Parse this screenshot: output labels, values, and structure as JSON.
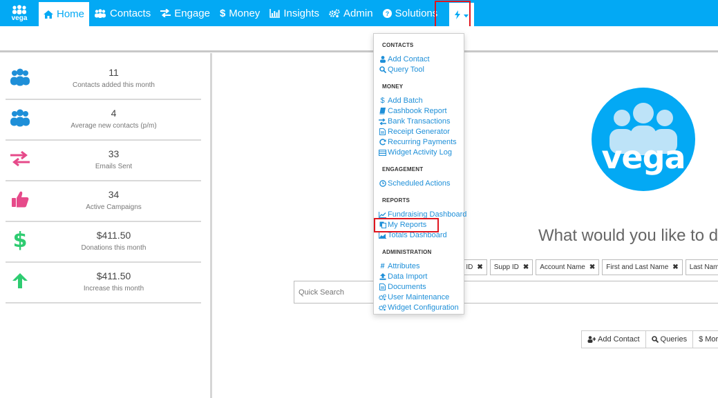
{
  "brand": {
    "logo_text": "vega",
    "accent": "#03a9f4"
  },
  "nav": {
    "home": "Home",
    "contacts": "Contacts",
    "engage": "Engage",
    "money": "Money",
    "insights": "Insights",
    "admin": "Admin",
    "solutions": "Solutions"
  },
  "stats": [
    {
      "value": "11",
      "label": "Contacts added this month",
      "icon": "users-icon"
    },
    {
      "value": "4",
      "label": "Average new contacts (p/m)",
      "icon": "users-icon"
    },
    {
      "value": "33",
      "label": "Emails Sent",
      "icon": "exchange-icon"
    },
    {
      "value": "34",
      "label": "Active Campaigns",
      "icon": "thumbs-up-icon"
    },
    {
      "value": "$411.50",
      "label": "Donations this month",
      "icon": "dollar-icon"
    },
    {
      "value": "$411.50",
      "label": "Increase this month",
      "icon": "arrow-up-icon"
    }
  ],
  "main": {
    "headline": "What would you like to do",
    "chips": [
      "n ID",
      "Supp ID",
      "Account Name",
      "First and Last Name",
      "Last Name"
    ],
    "quick_search_placeholder": "Quick Search",
    "buttons": {
      "add_contact": "Add Contact",
      "queries": "Queries",
      "money": "$ Mor"
    }
  },
  "dropdown": {
    "contacts_header": "CONTACTS",
    "add_contact": "Add Contact",
    "query_tool": "Query Tool",
    "money_header": "MONEY",
    "add_batch": "Add Batch",
    "cashbook_report": "Cashbook Report",
    "bank_transactions": "Bank Transactions",
    "receipt_generator": "Receipt Generator",
    "recurring_payments": "Recurring Payments",
    "widget_activity_log": "Widget Activity Log",
    "engagement_header": "ENGAGEMENT",
    "scheduled_actions": "Scheduled Actions",
    "reports_header": "REPORTS",
    "fundraising_dashboard": "Fundraising Dashboard",
    "my_reports": "My Reports",
    "totals_dashboard": "Totals Dashboard",
    "administration_header": "ADMINISTRATION",
    "attributes": "Attributes",
    "data_import": "Data Import",
    "documents": "Documents",
    "user_maintenance": "User Maintenance",
    "widget_configuration": "Widget Configuration"
  },
  "colors": {
    "users": "#1e8fd8",
    "exchange": "#e64a8a",
    "thumbs": "#e64a8a",
    "dollar": "#2ecc71",
    "arrow": "#2ecc71",
    "link": "#1e8fd8"
  }
}
